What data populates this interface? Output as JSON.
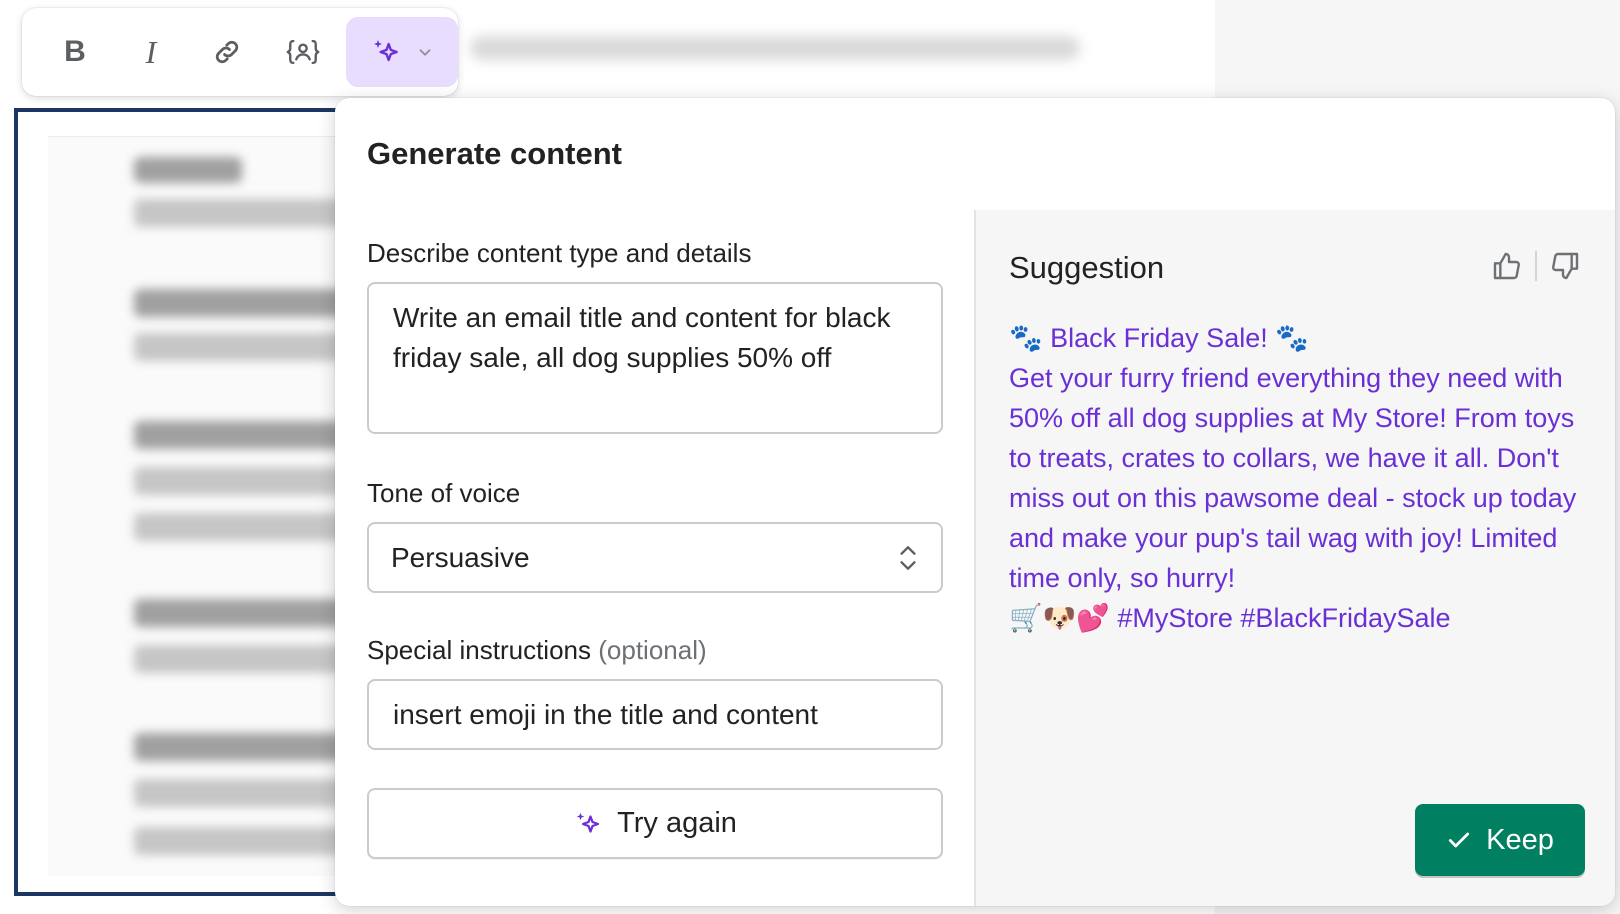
{
  "toolbar": {
    "bold_label": "B",
    "italic_label": "I",
    "buttons": [
      "bold-icon",
      "italic-icon",
      "link-icon",
      "variable-icon",
      "ai-sparkle-icon",
      "chevron-down-icon"
    ]
  },
  "dialog": {
    "title": "Generate content",
    "description_label": "Describe content type and details",
    "description_value": "Write an email title and content for black friday sale, all dog supplies 50% off",
    "tone_label": "Tone of voice",
    "tone_value": "Persuasive",
    "instructions_label": "Special instructions",
    "instructions_optional": "(optional)",
    "instructions_value": "insert emoji in the title and content",
    "try_again_label": "Try again"
  },
  "suggestion": {
    "title": "Suggestion",
    "heading_emoji_left": "🐾",
    "heading": "Black Friday Sale!",
    "heading_emoji_right": "🐾",
    "body": "Get your furry friend everything they need with 50% off all dog supplies at My Store! From toys to treats, crates to collars, we have it all. Don't miss out on this pawsome deal - stock up today and make your pup's tail wag with joy! Limited time only, so hurry!",
    "emoji_row": "🛒🐶💕",
    "hashtags": "#MyStore #BlackFridaySale",
    "keep_label": "Keep"
  },
  "colors": {
    "accent_purple": "#6a2fd6",
    "ai_button_bg": "#e8dcff",
    "keep_green": "#008060",
    "editor_frame": "#1c3664"
  }
}
